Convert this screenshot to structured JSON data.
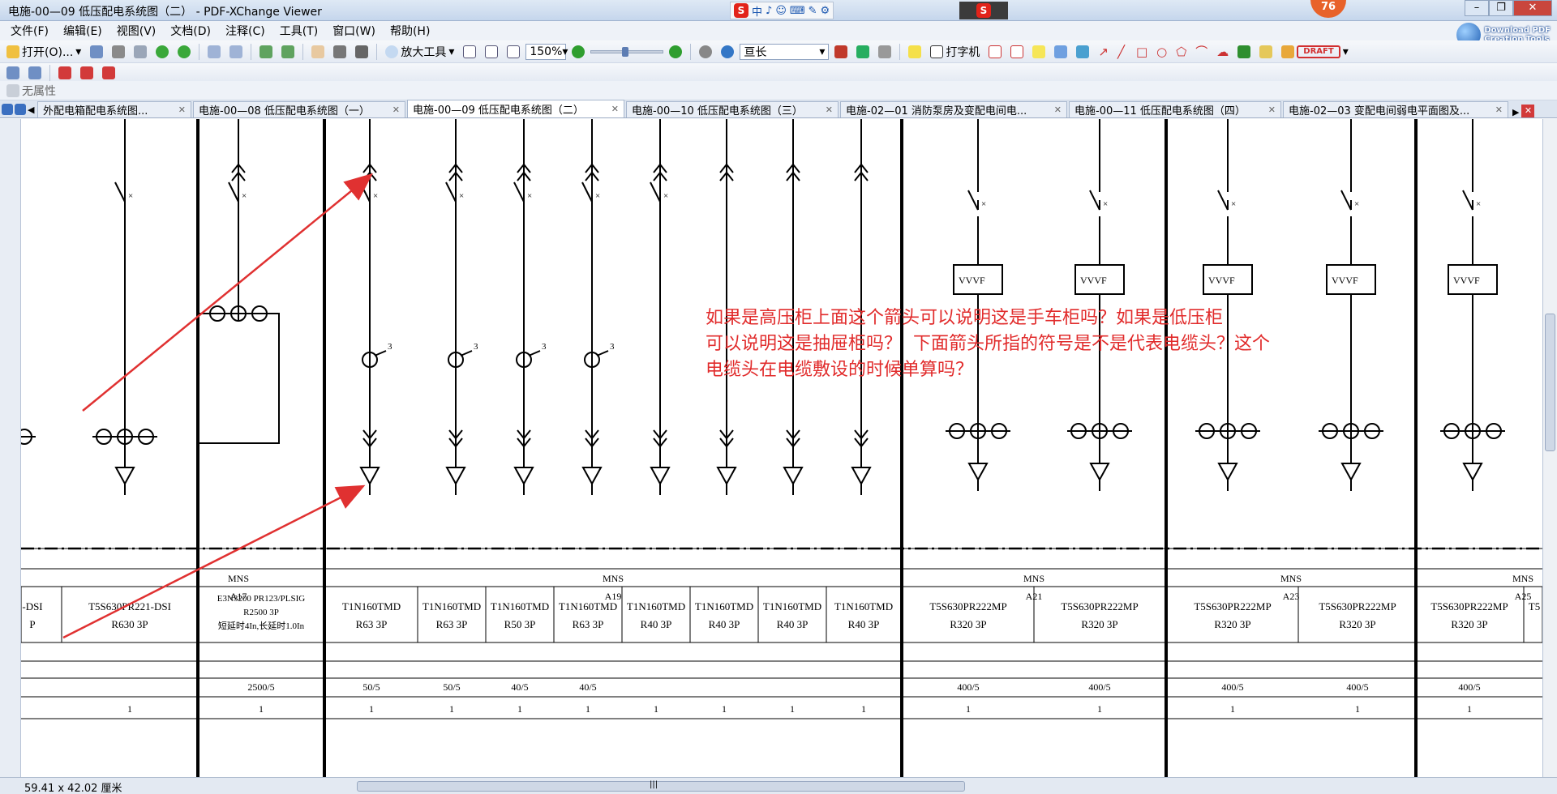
{
  "window": {
    "title": "电施-00—09 低压配电系统图（二） - PDF-XChange Viewer",
    "notification_count": "76"
  },
  "ime": {
    "items": [
      "中",
      "♪",
      "☺",
      "⌨",
      "✎",
      "⚙"
    ]
  },
  "menu": [
    "文件(F)",
    "编辑(E)",
    "视图(V)",
    "文档(D)",
    "注释(C)",
    "工具(T)",
    "窗口(W)",
    "帮助(H)"
  ],
  "download_promo": {
    "line1": "Download PDF",
    "line2": "Creation Tools"
  },
  "toolbar": {
    "open_label": "打开(O)...",
    "zoom_tool_label": "放大工具",
    "zoom_value": "150%",
    "find_value": "亘长",
    "typewriter_label": "打字机",
    "draft_label": "DRAFT"
  },
  "properties_label": "无属性",
  "tabs": [
    {
      "label": "外配电箱配电系统图...",
      "active": false
    },
    {
      "label": "电施-00—08 低压配电系统图（一）",
      "active": false
    },
    {
      "label": "电施-00—09 低压配电系统图（二）",
      "active": true
    },
    {
      "label": "电施-00—10 低压配电系统图（三）",
      "active": false
    },
    {
      "label": "电施-02—01 消防泵房及变配电间电...",
      "active": false
    },
    {
      "label": "电施-00—11 低压配电系统图（四）",
      "active": false
    },
    {
      "label": "电施-02—03 变配电间弱电平面图及...",
      "active": false
    }
  ],
  "question_text": "如果是高压柜上面这个箭头可以说明这是手车柜吗？如果是低压柜\n可以说明这是抽屉柜吗？  下面箭头所指的符号是不是代表电缆头？这个\n电缆头在电缆敷设的时候单算吗？",
  "schematic": {
    "cabinet_types": [
      "MNS",
      "MNS",
      "MNS",
      "MNS"
    ],
    "cabinet_ids": [
      "A17",
      "A19",
      "A21",
      "A23",
      "A25"
    ],
    "breakers": [
      {
        "line1": "-DSI",
        "line2": "P"
      },
      {
        "line1": "T5S630PR221-DSI",
        "line2": "R630  3P"
      },
      {
        "line1": "E3N3200  PR123/PLSIG",
        "line2": "R2500  3P",
        "line3": "短延时4In,长延时1.0In"
      },
      {
        "line1": "T1N160TMD",
        "line2": "R63  3P"
      },
      {
        "line1": "T1N160TMD",
        "line2": "R63  3P"
      },
      {
        "line1": "T1N160TMD",
        "line2": "R50  3P"
      },
      {
        "line1": "T1N160TMD",
        "line2": "R63  3P"
      },
      {
        "line1": "T1N160TMD",
        "line2": "R40  3P"
      },
      {
        "line1": "T1N160TMD",
        "line2": "R40  3P"
      },
      {
        "line1": "T1N160TMD",
        "line2": "R40  3P"
      },
      {
        "line1": "T1N160TMD",
        "line2": "R40  3P"
      },
      {
        "line1": "T5S630PR222MP",
        "line2": "R320  3P"
      },
      {
        "line1": "T5S630PR222MP",
        "line2": "R320  3P"
      },
      {
        "line1": "T5S630PR222MP",
        "line2": "R320  3P"
      },
      {
        "line1": "T5S630PR222MP",
        "line2": "R320  3P"
      },
      {
        "line1": "T5S630PR222MP",
        "line2": "R320  3P"
      },
      {
        "line1": "T5",
        "line2": ""
      }
    ],
    "ct_ratios": [
      "2500/5",
      "50/5",
      "50/5",
      "40/5",
      "40/5",
      "400/5",
      "400/5",
      "400/5",
      "400/5",
      "400/5"
    ],
    "quantities": [
      "1",
      "1",
      "1",
      "1",
      "1",
      "1",
      "1",
      "1",
      "1",
      "1",
      "1",
      "1",
      "1",
      "1",
      "1"
    ],
    "vvvf_label": "VVVF",
    "ct_count_label": "3"
  },
  "status": {
    "page_size": "59.41 x 42.02 厘米",
    "hscroll_grip": "|||"
  }
}
